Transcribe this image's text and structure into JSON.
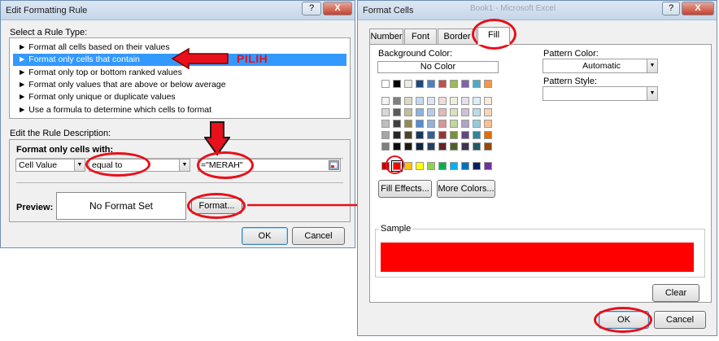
{
  "rule_dialog": {
    "title": "Edit Formatting Rule",
    "help": "?",
    "close": "X",
    "select_label": "Select a Rule Type:",
    "rule_types": [
      "► Format all cells based on their values",
      "► Format only cells that contain",
      "► Format only top or bottom ranked values",
      "► Format only values that are above or below average",
      "► Format only unique or duplicate values",
      "► Use a formula to determine which cells to format"
    ],
    "selected_rule": 1,
    "annotation": "PILIH",
    "edit_label": "Edit the Rule Description:",
    "format_only_label": "Format only cells with:",
    "condition_field": "Cell Value",
    "condition_operator": "equal to",
    "condition_value": "=\"MERAH\"",
    "preview_label": "Preview:",
    "preview_text": "No Format Set",
    "format_button": "Format...",
    "ok": "OK",
    "cancel": "Cancel"
  },
  "format_dialog": {
    "title": "Format Cells",
    "bg_title": "Book1 - Microsoft Excel",
    "help": "?",
    "close": "X",
    "tabs": [
      "Number",
      "Font",
      "Border",
      "Fill"
    ],
    "active_tab": "Fill",
    "background_color_label": "Background Color:",
    "no_color": "No Color",
    "theme_row": [
      "#ffffff",
      "#000000",
      "#eeece1",
      "#1f497d",
      "#4f81bd",
      "#c0504d",
      "#9bbb59",
      "#8064a2",
      "#4bacc6",
      "#f79646"
    ],
    "tint_rows": [
      [
        "#f2f2f2",
        "#7f7f7f",
        "#ddd9c3",
        "#c6d9f0",
        "#dbe5f1",
        "#f2dcdb",
        "#ebf1dd",
        "#e5e0ec",
        "#dbeef3",
        "#fdeada"
      ],
      [
        "#d8d8d8",
        "#595959",
        "#c4bd97",
        "#8db3e2",
        "#b8cce4",
        "#e5b9b7",
        "#d7e3bc",
        "#ccc1d9",
        "#b7dde8",
        "#fbd5b5"
      ],
      [
        "#bfbfbf",
        "#3f3f3f",
        "#938953",
        "#548dd4",
        "#95b3d7",
        "#d99694",
        "#c3d69b",
        "#b2a2c7",
        "#92cddc",
        "#fac08f"
      ],
      [
        "#a5a5a5",
        "#262626",
        "#494429",
        "#17365d",
        "#366092",
        "#953734",
        "#76923c",
        "#5f497a",
        "#31859b",
        "#e36c09"
      ],
      [
        "#7f7f7f",
        "#0c0c0c",
        "#1d1b10",
        "#0f243e",
        "#244061",
        "#632423",
        "#4f6128",
        "#3f3151",
        "#205867",
        "#974806"
      ]
    ],
    "standard_row": [
      "#c00000",
      "#ff0000",
      "#ffc000",
      "#ffff00",
      "#92d050",
      "#00b050",
      "#00b0f0",
      "#0070c0",
      "#002060",
      "#7030a0"
    ],
    "selected_swatch": 1,
    "fill_effects": "Fill Effects...",
    "more_colors": "More Colors...",
    "pattern_color_label": "Pattern Color:",
    "pattern_color_value": "Automatic",
    "pattern_style_label": "Pattern Style:",
    "pattern_style_value": "",
    "sample_label": "Sample",
    "sample_color": "#ff0000",
    "clear": "Clear",
    "ok": "OK",
    "cancel": "Cancel"
  },
  "colors": {
    "annotation_red": "#e8101a",
    "selection_blue": "#3399ff"
  }
}
